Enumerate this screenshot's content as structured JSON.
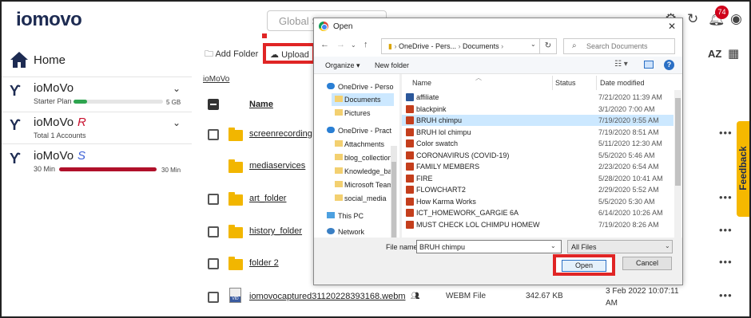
{
  "app": {
    "logo": "iomovo",
    "search_placeholder": "Global S",
    "notifications_count": "74",
    "feedback_label": "Feedback"
  },
  "sidebar": {
    "home_label": "Home",
    "accounts": [
      {
        "name": "ioMoVo",
        "tag": "",
        "sub": "Starter Plan",
        "usage_label": "5 GB",
        "usage_fraction": 0.15,
        "usage_color": "#2ea44f"
      },
      {
        "name": "ioMoVo",
        "tag": "R",
        "sub": "Total 1 Accounts"
      },
      {
        "name": "ioMoVo",
        "tag": "S",
        "sub": "30 Min",
        "usage_label": "30 Min",
        "usage_fraction": 1.0,
        "usage_color": "#b0102a"
      }
    ]
  },
  "main": {
    "add_folder_label": "Add Folder",
    "upload_label": "Upload",
    "breadcrumb": "ioMoVo",
    "name_header": "Name",
    "rows": [
      {
        "name": "screenrecording",
        "type": "folder"
      },
      {
        "name": "mediaservices",
        "type": "folder"
      },
      {
        "name": "art_folder",
        "type": "folder"
      },
      {
        "name": "history_folder",
        "type": "folder"
      },
      {
        "name": "folder 2",
        "type": "folder"
      },
      {
        "name": "iomovocaptured31120228393168.webm",
        "type": "file",
        "kind": "WEBM File",
        "size": "342.67 KB",
        "date_line1": "3 Feb 2022 10:07:11",
        "date_line2": "AM"
      }
    ]
  },
  "dialog": {
    "title": "Open",
    "address_parts": [
      "OneDrive - Pers...",
      "Documents"
    ],
    "search_placeholder": "Search Documents",
    "organize_label": "Organize ▾",
    "new_folder_label": "New folder",
    "nav_items": [
      {
        "label": "OneDrive - Perso",
        "icon": "cloud"
      },
      {
        "label": "Documents",
        "icon": "folder",
        "selected": true
      },
      {
        "label": "Pictures",
        "icon": "folder"
      },
      {
        "label": "OneDrive - Pract",
        "icon": "cloud"
      },
      {
        "label": "Attachments",
        "icon": "folder"
      },
      {
        "label": "blog_collection",
        "icon": "folder"
      },
      {
        "label": "Knowledge_ba",
        "icon": "folder"
      },
      {
        "label": "Microsoft Team",
        "icon": "folder"
      },
      {
        "label": "social_media",
        "icon": "folder"
      },
      {
        "label": "This PC",
        "icon": "pc"
      },
      {
        "label": "Network",
        "icon": "network"
      }
    ],
    "columns": {
      "name": "Name",
      "status": "Status",
      "date": "Date modified"
    },
    "files": [
      {
        "name": "affiliate",
        "date": "7/21/2020 11:39 AM",
        "kind": "doc"
      },
      {
        "name": "blackpink",
        "date": "3/1/2020 7:00 AM",
        "kind": "ppt"
      },
      {
        "name": "BRUH chimpu",
        "date": "7/19/2020 9:55 AM",
        "kind": "ppt",
        "selected": true
      },
      {
        "name": "BRUH lol chimpu",
        "date": "7/19/2020 8:51 AM",
        "kind": "ppt"
      },
      {
        "name": "Color swatch",
        "date": "5/11/2020 12:30 AM",
        "kind": "ppt"
      },
      {
        "name": "CORONAVIRUS (COVID-19)",
        "date": "5/5/2020 5:46 AM",
        "kind": "ppt"
      },
      {
        "name": "FAMILY MEMBERS",
        "date": "2/23/2020 6:54 AM",
        "kind": "ppt"
      },
      {
        "name": "FIRE",
        "date": "5/28/2020 10:41 AM",
        "kind": "ppt"
      },
      {
        "name": "FLOWCHART2",
        "date": "2/29/2020 5:52 AM",
        "kind": "ppt"
      },
      {
        "name": "How Karma Works",
        "date": "5/5/2020 5:30 AM",
        "kind": "ppt"
      },
      {
        "name": "ICT_HOMEWORK_GARGIE 6A",
        "date": "6/14/2020 10:26 AM",
        "kind": "ppt"
      },
      {
        "name": "MUST CHECK LOL CHIMPU HOMEW",
        "date": "7/19/2020 8:26 AM",
        "kind": "ppt"
      }
    ],
    "filename_label": "File name:",
    "filename_value": "BRUH chimpu",
    "filetype_value": "All Files",
    "open_label": "Open",
    "cancel_label": "Cancel"
  }
}
